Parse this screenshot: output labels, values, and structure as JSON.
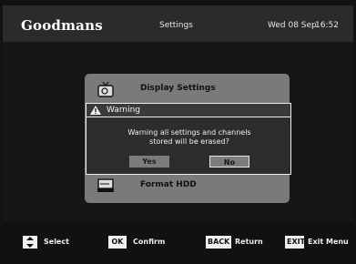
{
  "header": {
    "brand": "Goodmans",
    "screen_title": "Settings",
    "date": "Wed 08 Sep",
    "time": "16:52"
  },
  "menu": {
    "items": [
      {
        "label": "Display Settings",
        "icon": "tv-icon"
      },
      {
        "label": "Format HDD",
        "icon": "hdd-icon"
      }
    ]
  },
  "dialog": {
    "title": "Warning",
    "icon": "warning-icon",
    "message_line1": "Warning all settings and channels",
    "message_line2": "stored will be erased?",
    "yes_label": "Yes",
    "no_label": "No",
    "selected": "No"
  },
  "footer": {
    "select_key_icon": "up-down-arrows-icon",
    "select_label": "Select",
    "ok_key": "OK",
    "confirm_label": "Confirm",
    "back_key": "BACK",
    "return_label": "Return",
    "exit_key": "EXIT",
    "exit_label": "Exit Menu"
  }
}
